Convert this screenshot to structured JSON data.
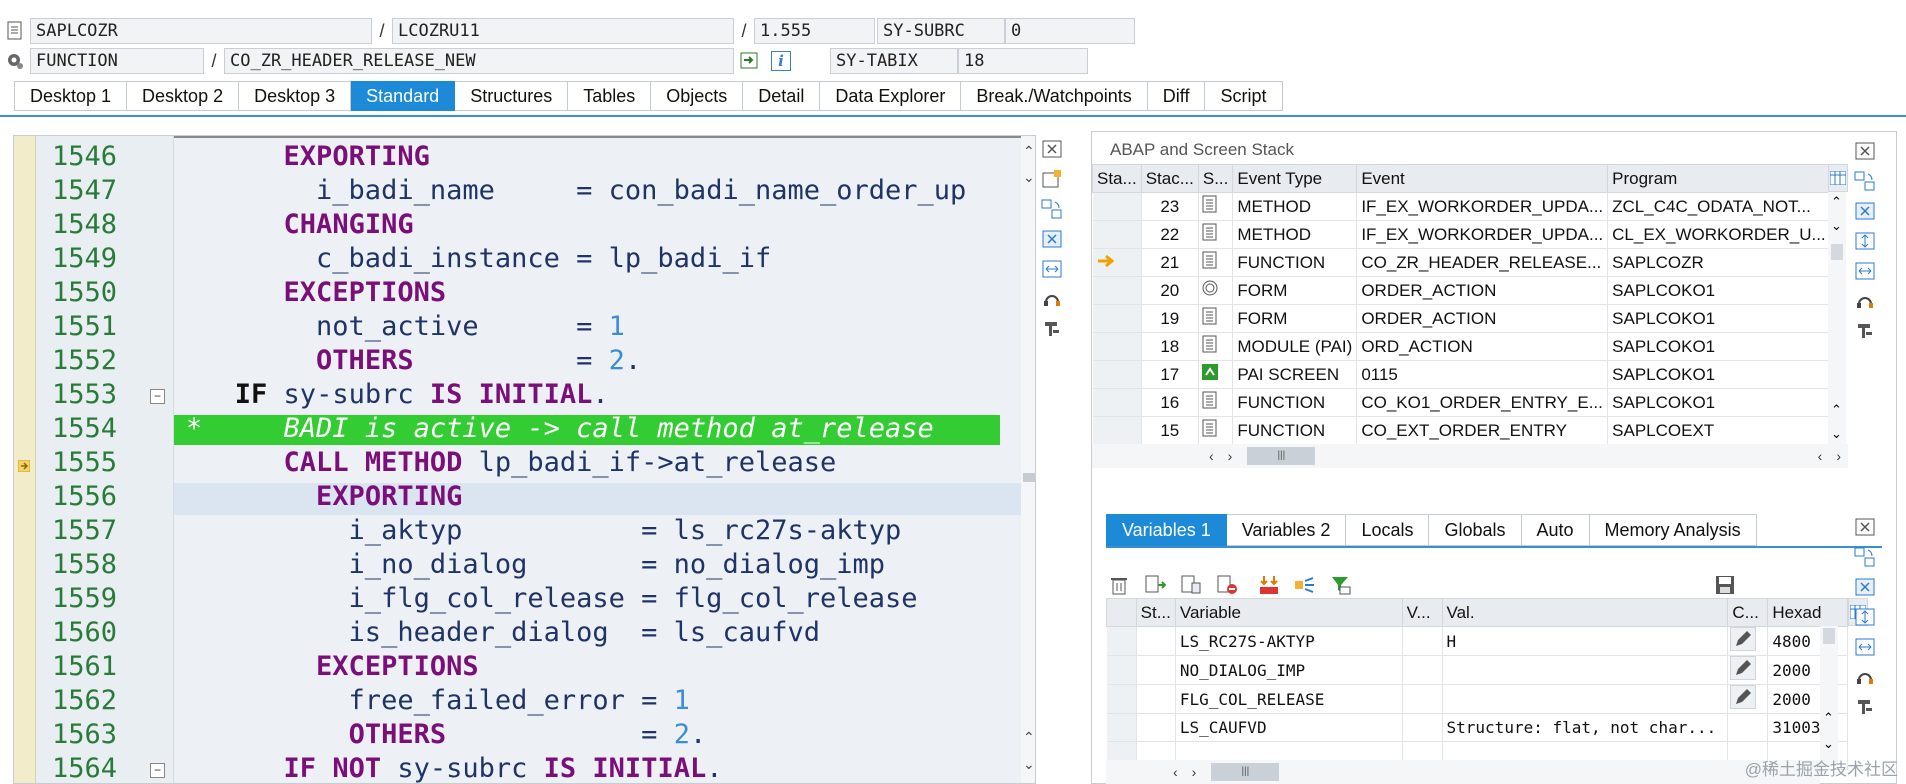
{
  "header": {
    "program_field": "SAPLCOZR",
    "include_field": "LCOZRU11",
    "line_field": "1.555",
    "subrc_label": "SY-SUBRC",
    "subrc_value": "0",
    "type_field": "FUNCTION",
    "name_field": "CO_ZR_HEADER_RELEASE_NEW",
    "tabix_label": "SY-TABIX",
    "tabix_value": "18",
    "slash": "/",
    "info_icon": "i"
  },
  "tabs": [
    "Desktop 1",
    "Desktop 2",
    "Desktop 3",
    "Standard",
    "Structures",
    "Tables",
    "Objects",
    "Detail",
    "Data Explorer",
    "Break./Watchpoints",
    "Diff",
    "Script"
  ],
  "active_tab": "Standard",
  "editor": {
    "lines": [
      {
        "n": "1546",
        "parts": [
          {
            "t": "      ",
            "c": "sp"
          },
          {
            "t": "EXPORTING",
            "c": "kw"
          }
        ]
      },
      {
        "n": "1547",
        "parts": [
          {
            "t": "        i_badi_name     ",
            "c": "ident"
          },
          {
            "t": "= ",
            "c": "op"
          },
          {
            "t": "con_badi_name_order_up",
            "c": "ident"
          }
        ]
      },
      {
        "n": "1548",
        "parts": [
          {
            "t": "      ",
            "c": "sp"
          },
          {
            "t": "CHANGING",
            "c": "kw"
          }
        ]
      },
      {
        "n": "1549",
        "parts": [
          {
            "t": "        c_badi_instance ",
            "c": "ident"
          },
          {
            "t": "= ",
            "c": "op"
          },
          {
            "t": "lp_badi_if",
            "c": "ident"
          }
        ]
      },
      {
        "n": "1550",
        "parts": [
          {
            "t": "      ",
            "c": "sp"
          },
          {
            "t": "EXCEPTIONS",
            "c": "kw"
          }
        ]
      },
      {
        "n": "1551",
        "parts": [
          {
            "t": "        not_active      ",
            "c": "ident"
          },
          {
            "t": "= ",
            "c": "op"
          },
          {
            "t": "1",
            "c": "num"
          }
        ]
      },
      {
        "n": "1552",
        "parts": [
          {
            "t": "        ",
            "c": "sp"
          },
          {
            "t": "OTHERS",
            "c": "kw"
          },
          {
            "t": "          = ",
            "c": "op"
          },
          {
            "t": "2",
            "c": "num"
          },
          {
            "t": ".",
            "c": "op"
          }
        ]
      },
      {
        "n": "1553",
        "parts": [
          {
            "t": "   ",
            "c": "sp"
          },
          {
            "t": "IF",
            "c": "plain"
          },
          {
            "t": " sy-subrc ",
            "c": "ident"
          },
          {
            "t": "IS INITIAL",
            "c": "kw"
          },
          {
            "t": ".",
            "c": "op"
          }
        ]
      },
      {
        "n": "1554",
        "parts": [
          {
            "t": "*     BADI is active -> call method at_release",
            "c": "cmt"
          }
        ]
      },
      {
        "n": "1555",
        "parts": [
          {
            "t": "      ",
            "c": "sp"
          },
          {
            "t": "CALL METHOD",
            "c": "kw"
          },
          {
            "t": " lp_badi_if->at_release",
            "c": "ident"
          }
        ]
      },
      {
        "n": "1556",
        "parts": [
          {
            "t": "        ",
            "c": "sp"
          },
          {
            "t": "EXPORTING",
            "c": "kw"
          }
        ]
      },
      {
        "n": "1557",
        "parts": [
          {
            "t": "          i_aktyp           ",
            "c": "ident"
          },
          {
            "t": "= ",
            "c": "op"
          },
          {
            "t": "ls_rc27s-aktyp",
            "c": "ident"
          }
        ]
      },
      {
        "n": "1558",
        "parts": [
          {
            "t": "          i_no_dialog       ",
            "c": "ident"
          },
          {
            "t": "= ",
            "c": "op"
          },
          {
            "t": "no_dialog_imp",
            "c": "ident"
          }
        ]
      },
      {
        "n": "1559",
        "parts": [
          {
            "t": "          i_flg_col_release ",
            "c": "ident"
          },
          {
            "t": "= ",
            "c": "op"
          },
          {
            "t": "flg_col_release",
            "c": "ident"
          }
        ]
      },
      {
        "n": "1560",
        "parts": [
          {
            "t": "          is_header_dialog  ",
            "c": "ident"
          },
          {
            "t": "= ",
            "c": "op"
          },
          {
            "t": "ls_caufvd",
            "c": "ident"
          }
        ]
      },
      {
        "n": "1561",
        "parts": [
          {
            "t": "        ",
            "c": "sp"
          },
          {
            "t": "EXCEPTIONS",
            "c": "kw"
          }
        ]
      },
      {
        "n": "1562",
        "parts": [
          {
            "t": "          free_failed_error ",
            "c": "ident"
          },
          {
            "t": "= ",
            "c": "op"
          },
          {
            "t": "1",
            "c": "num"
          }
        ]
      },
      {
        "n": "1563",
        "parts": [
          {
            "t": "          ",
            "c": "sp"
          },
          {
            "t": "OTHERS",
            "c": "kw"
          },
          {
            "t": "            = ",
            "c": "op"
          },
          {
            "t": "2",
            "c": "num"
          },
          {
            "t": ".",
            "c": "op"
          }
        ]
      },
      {
        "n": "1564",
        "parts": [
          {
            "t": "      ",
            "c": "sp"
          },
          {
            "t": "IF NOT",
            "c": "kw"
          },
          {
            "t": " sy-subrc ",
            "c": "ident"
          },
          {
            "t": "IS INITIAL",
            "c": "kw"
          },
          {
            "t": ".",
            "c": "op"
          }
        ]
      }
    ]
  },
  "stack": {
    "title": "ABAP and Screen Stack",
    "columns": [
      "Sta...",
      "Stac...",
      "S...",
      "Event Type",
      "Event",
      "Program"
    ],
    "rows": [
      {
        "level": "23",
        "icon": "doc-icon",
        "type": "METHOD",
        "event": "IF_EX_WORKORDER_UPDA...",
        "program": "ZCL_C4C_ODATA_NOT..."
      },
      {
        "level": "22",
        "icon": "doc-icon",
        "type": "METHOD",
        "event": "IF_EX_WORKORDER_UPDA...",
        "program": "CL_EX_WORKORDER_U..."
      },
      {
        "level": "21",
        "icon": "doc-icon",
        "type": "FUNCTION",
        "event": "CO_ZR_HEADER_RELEASE...",
        "program": "SAPLCOZR",
        "current": true
      },
      {
        "level": "20",
        "icon": "form-icon",
        "type": "FORM",
        "event": "ORDER_ACTION",
        "program": "SAPLCOKO1"
      },
      {
        "level": "19",
        "icon": "doc-icon",
        "type": "FORM",
        "event": "ORDER_ACTION",
        "program": "SAPLCOKO1"
      },
      {
        "level": "18",
        "icon": "doc-icon",
        "type": "MODULE (PAI)",
        "event": "ORD_ACTION",
        "program": "SAPLCOKO1"
      },
      {
        "level": "17",
        "icon": "screen-icon",
        "type": "PAI SCREEN",
        "event": "0115",
        "program": "SAPLCOKO1"
      },
      {
        "level": "16",
        "icon": "doc-icon",
        "type": "FUNCTION",
        "event": "CO_KO1_ORDER_ENTRY_E...",
        "program": "SAPLCOKO1"
      },
      {
        "level": "15",
        "icon": "doc-icon",
        "type": "FUNCTION",
        "event": "CO_EXT_ORDER_ENTRY",
        "program": "SAPLCOEXT"
      }
    ]
  },
  "variables": {
    "tabs": [
      "Variables 1",
      "Variables 2",
      "Locals",
      "Globals",
      "Auto",
      "Memory Analysis"
    ],
    "active_tab": "Variables 1",
    "columns": [
      "St...",
      "Variable",
      "V...",
      "Val.",
      "C...",
      "Hexad"
    ],
    "rows": [
      {
        "variable": "LS_RC27S-AKTYP",
        "value": "H",
        "hex": "4800",
        "editable": true
      },
      {
        "variable": "NO_DIALOG_IMP",
        "value": "",
        "hex": "2000",
        "editable": true
      },
      {
        "variable": "FLG_COL_RELEASE",
        "value": "",
        "hex": "2000",
        "editable": true
      },
      {
        "variable": "LS_CAUFVD",
        "value": "Structure: flat, not char...",
        "hex": "31003",
        "editable": false
      },
      {
        "variable": "",
        "value": "",
        "hex": "",
        "editable": false
      }
    ]
  },
  "watermark": "@稀土掘金技术社区",
  "colors": {
    "accent": "#1c8ad6",
    "current_line": "#33cc33",
    "keyword": "#7a0f7a",
    "line_number": "#2a7a3a"
  }
}
